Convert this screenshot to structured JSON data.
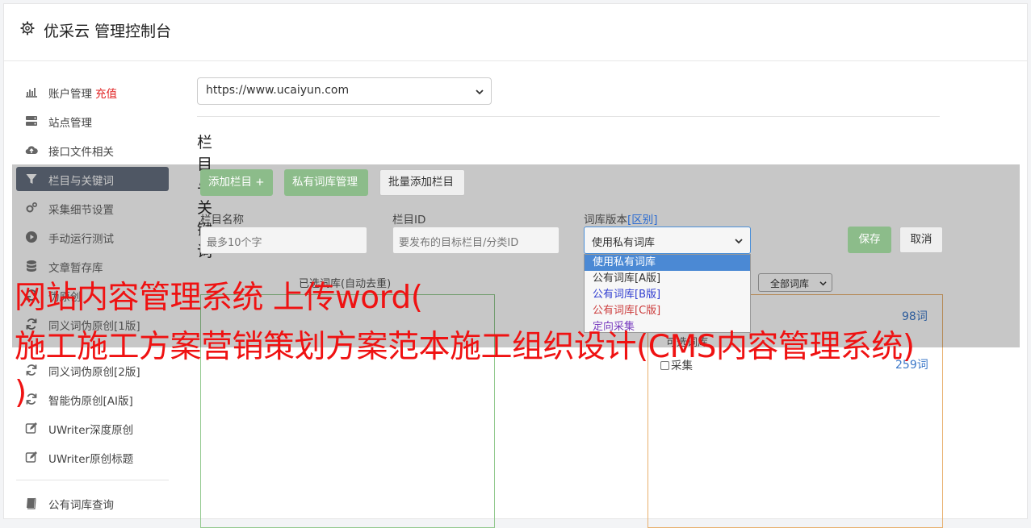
{
  "header": {
    "title": "优采云 管理控制台",
    "icon": "gear-icon"
  },
  "sidebar": {
    "items": [
      {
        "label": "账户管理",
        "extra": "充值",
        "icon": "bar-chart-icon"
      },
      {
        "label": "站点管理",
        "icon": "server-icon"
      },
      {
        "label": "接口文件相关",
        "icon": "cloud-upload-icon"
      },
      {
        "label": "栏目与关键词",
        "icon": "filter-icon",
        "active": true
      },
      {
        "label": "采集细节设置",
        "icon": "gears-icon"
      },
      {
        "label": "手动运行测试",
        "icon": "play-circle-icon"
      },
      {
        "label": "文章暂存库",
        "icon": "database-icon"
      },
      {
        "label": "伪原创",
        "icon": "refresh-icon"
      },
      {
        "label": "同义词伪原创[1版]",
        "icon": "refresh-icon"
      },
      {
        "label": "同义词伪原创[2版]",
        "icon": "refresh-icon"
      },
      {
        "label": "智能伪原创[AI版]",
        "icon": "refresh-icon"
      },
      {
        "label": "UWriter深度原创",
        "icon": "edit-icon"
      },
      {
        "label": "UWriter原创标题",
        "icon": "edit-icon"
      },
      {
        "label": "公有词库查询",
        "icon": "book-icon"
      }
    ]
  },
  "main": {
    "site_select": "https://www.ucaiyun.com",
    "section_title": "栏目与关键词",
    "buttons": {
      "add_column": "添加栏目 +",
      "private_lib": "私有词库管理",
      "batch_add": "批量添加栏目"
    },
    "form": {
      "name_label": "栏目名称",
      "name_placeholder": "最多10个字",
      "id_label": "栏目ID",
      "id_placeholder": "要发布的目标栏目/分类ID",
      "version_label": "词库版本",
      "version_link": "[区别]",
      "version_value": "使用私有词库",
      "save": "保存",
      "cancel": "取消"
    },
    "version_options": [
      "使用私有词库",
      "公有词库[A版]",
      "公有词库[B版]",
      "公有词库[C版]",
      "定向采集"
    ],
    "selected_caption": "已选词库(自动去重)",
    "all_libs_select": "全部词库",
    "right_panel": {
      "caption_partial": "可选词库",
      "rows": [
        {
          "label": "",
          "count": "98词"
        },
        {
          "label": "",
          "count": ""
        },
        {
          "label": "采集",
          "count": "259词"
        }
      ]
    }
  },
  "watermark": {
    "line1": "网站内容管理系统 上传word(",
    "line2": "施工施工方案营销策划方案范本施工组织设计(CMS内容管理系统)",
    "line3": ")"
  },
  "colors": {
    "accent_green": "#8cbc8a",
    "link_blue": "#2b6bd1",
    "warning_red": "#ef1212"
  }
}
